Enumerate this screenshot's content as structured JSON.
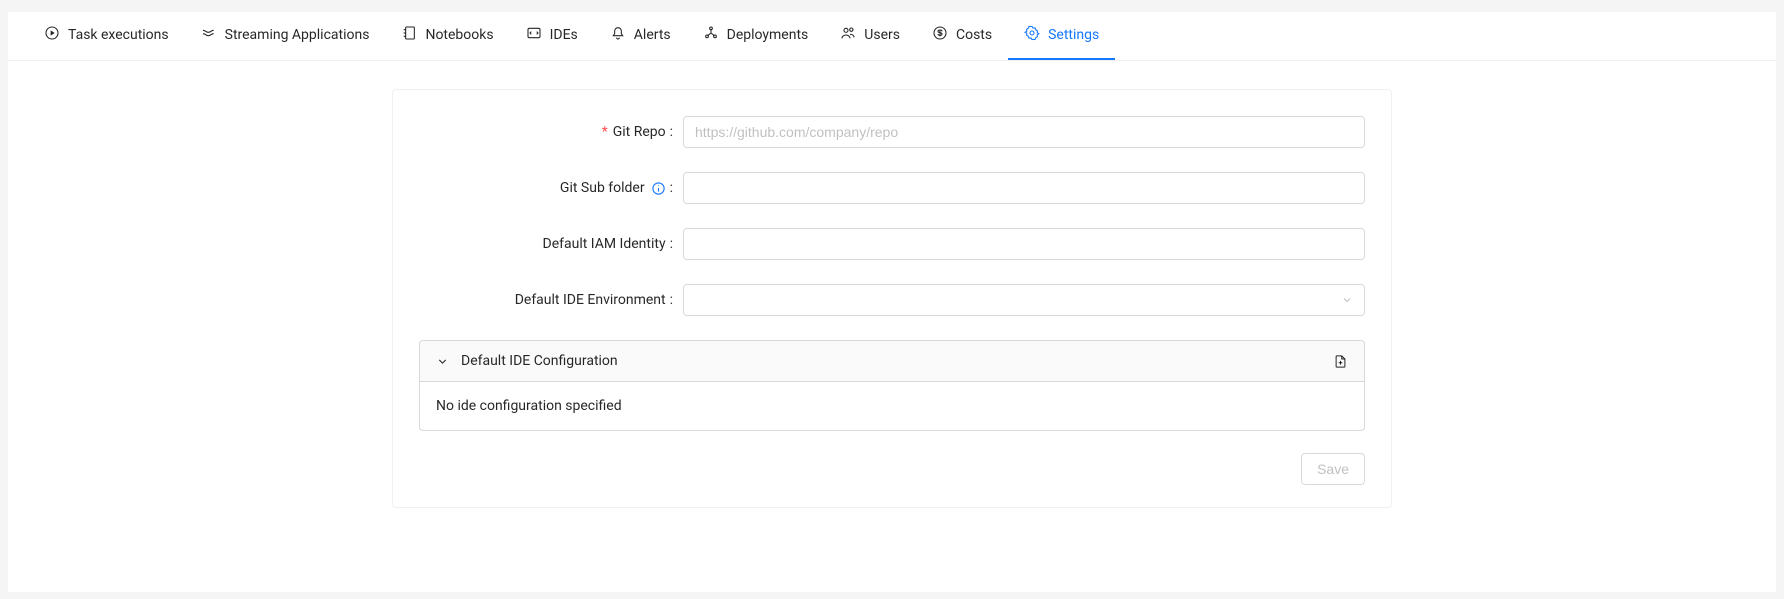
{
  "tabs": [
    {
      "label": "Task executions",
      "icon": "play-circle-icon"
    },
    {
      "label": "Streaming Applications",
      "icon": "stream-icon"
    },
    {
      "label": "Notebooks",
      "icon": "notebook-icon"
    },
    {
      "label": "IDEs",
      "icon": "ide-icon"
    },
    {
      "label": "Alerts",
      "icon": "alert-icon"
    },
    {
      "label": "Deployments",
      "icon": "deployment-icon"
    },
    {
      "label": "Users",
      "icon": "users-icon"
    },
    {
      "label": "Costs",
      "icon": "dollar-icon"
    },
    {
      "label": "Settings",
      "icon": "settings-icon",
      "active": true
    }
  ],
  "form": {
    "gitRepo": {
      "label": "Git Repo",
      "required": true,
      "placeholder": "https://github.com/company/repo",
      "value": ""
    },
    "gitSubFolder": {
      "label": "Git Sub folder",
      "value": "",
      "info": true
    },
    "iamIdentity": {
      "label": "Default IAM Identity",
      "value": ""
    },
    "ideEnv": {
      "label": "Default IDE Environment",
      "value": ""
    }
  },
  "collapse": {
    "title": "Default IDE Configuration",
    "body": "No ide configuration specified"
  },
  "footer": {
    "saveLabel": "Save"
  }
}
